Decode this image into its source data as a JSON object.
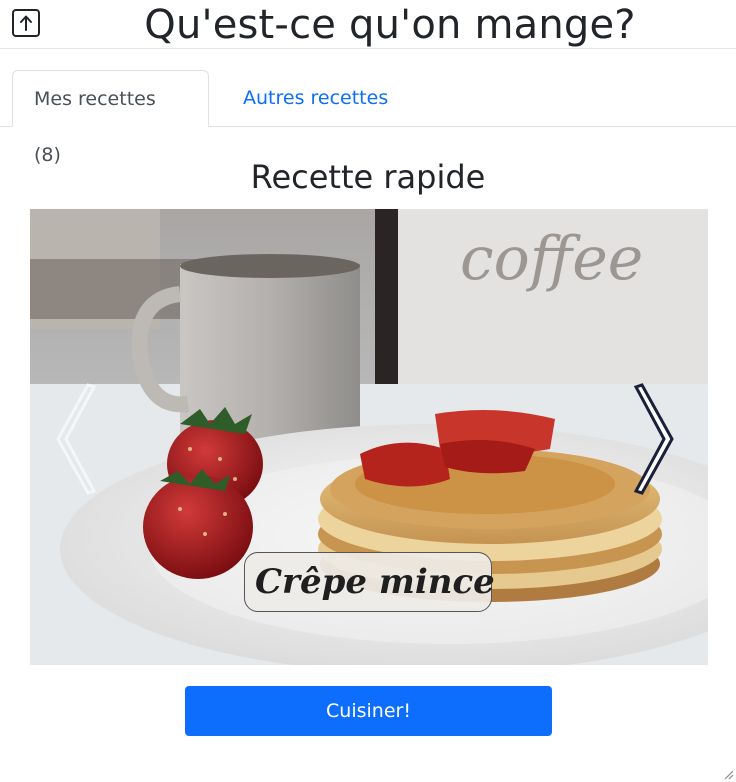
{
  "header": {
    "title": "Qu'est-ce qu'on mange?",
    "back_icon": "arrow-up-box-icon"
  },
  "tabs": [
    {
      "label": "Mes recettes (8)",
      "active": true
    },
    {
      "label": "Autres recettes",
      "active": false
    }
  ],
  "main": {
    "section_title": "Recette rapide",
    "carousel": {
      "caption": "Crêpe mince",
      "prev_icon": "chevron-left-icon",
      "next_icon": "chevron-right-icon"
    },
    "cook_button": "Cuisiner!"
  },
  "colors": {
    "accent": "#0d6efd",
    "text": "#212529"
  }
}
